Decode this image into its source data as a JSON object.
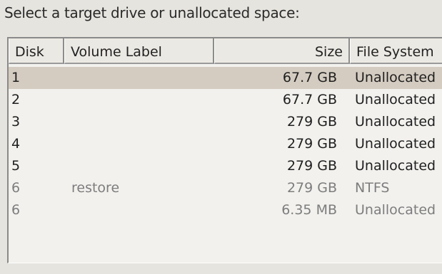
{
  "prompt": "Select a target drive or unallocated space:",
  "columns": {
    "disk": "Disk",
    "volume_label": "Volume Label",
    "size": "Size",
    "file_system": "File System"
  },
  "rows": [
    {
      "disk": "1",
      "volume_label": "",
      "size": "67.7 GB",
      "file_system": "Unallocated"
    },
    {
      "disk": "2",
      "volume_label": "",
      "size": "67.7 GB",
      "file_system": "Unallocated"
    },
    {
      "disk": "3",
      "volume_label": "",
      "size": "279 GB",
      "file_system": "Unallocated"
    },
    {
      "disk": "4",
      "volume_label": "",
      "size": "279 GB",
      "file_system": "Unallocated"
    },
    {
      "disk": "5",
      "volume_label": "",
      "size": "279 GB",
      "file_system": "Unallocated"
    },
    {
      "disk": "6",
      "volume_label": "restore",
      "size": "279 GB",
      "file_system": "NTFS"
    },
    {
      "disk": "6",
      "volume_label": "",
      "size": "6.35 MB",
      "file_system": "Unallocated"
    }
  ],
  "colors": {
    "selected_row": "#d4ccc0",
    "disabled_text": "#7d7d7d"
  }
}
